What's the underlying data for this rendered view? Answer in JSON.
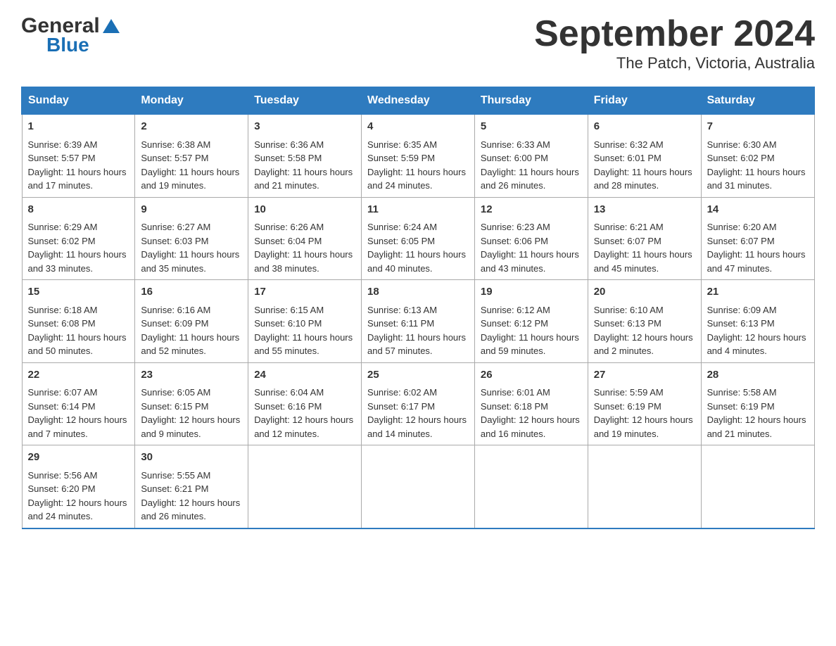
{
  "logo": {
    "general": "General",
    "blue": "Blue"
  },
  "title": "September 2024",
  "subtitle": "The Patch, Victoria, Australia",
  "days": [
    "Sunday",
    "Monday",
    "Tuesday",
    "Wednesday",
    "Thursday",
    "Friday",
    "Saturday"
  ],
  "weeks": [
    [
      {
        "day": "1",
        "sunrise": "6:39 AM",
        "sunset": "5:57 PM",
        "daylight": "11 hours and 17 minutes."
      },
      {
        "day": "2",
        "sunrise": "6:38 AM",
        "sunset": "5:57 PM",
        "daylight": "11 hours and 19 minutes."
      },
      {
        "day": "3",
        "sunrise": "6:36 AM",
        "sunset": "5:58 PM",
        "daylight": "11 hours and 21 minutes."
      },
      {
        "day": "4",
        "sunrise": "6:35 AM",
        "sunset": "5:59 PM",
        "daylight": "11 hours and 24 minutes."
      },
      {
        "day": "5",
        "sunrise": "6:33 AM",
        "sunset": "6:00 PM",
        "daylight": "11 hours and 26 minutes."
      },
      {
        "day": "6",
        "sunrise": "6:32 AM",
        "sunset": "6:01 PM",
        "daylight": "11 hours and 28 minutes."
      },
      {
        "day": "7",
        "sunrise": "6:30 AM",
        "sunset": "6:02 PM",
        "daylight": "11 hours and 31 minutes."
      }
    ],
    [
      {
        "day": "8",
        "sunrise": "6:29 AM",
        "sunset": "6:02 PM",
        "daylight": "11 hours and 33 minutes."
      },
      {
        "day": "9",
        "sunrise": "6:27 AM",
        "sunset": "6:03 PM",
        "daylight": "11 hours and 35 minutes."
      },
      {
        "day": "10",
        "sunrise": "6:26 AM",
        "sunset": "6:04 PM",
        "daylight": "11 hours and 38 minutes."
      },
      {
        "day": "11",
        "sunrise": "6:24 AM",
        "sunset": "6:05 PM",
        "daylight": "11 hours and 40 minutes."
      },
      {
        "day": "12",
        "sunrise": "6:23 AM",
        "sunset": "6:06 PM",
        "daylight": "11 hours and 43 minutes."
      },
      {
        "day": "13",
        "sunrise": "6:21 AM",
        "sunset": "6:07 PM",
        "daylight": "11 hours and 45 minutes."
      },
      {
        "day": "14",
        "sunrise": "6:20 AM",
        "sunset": "6:07 PM",
        "daylight": "11 hours and 47 minutes."
      }
    ],
    [
      {
        "day": "15",
        "sunrise": "6:18 AM",
        "sunset": "6:08 PM",
        "daylight": "11 hours and 50 minutes."
      },
      {
        "day": "16",
        "sunrise": "6:16 AM",
        "sunset": "6:09 PM",
        "daylight": "11 hours and 52 minutes."
      },
      {
        "day": "17",
        "sunrise": "6:15 AM",
        "sunset": "6:10 PM",
        "daylight": "11 hours and 55 minutes."
      },
      {
        "day": "18",
        "sunrise": "6:13 AM",
        "sunset": "6:11 PM",
        "daylight": "11 hours and 57 minutes."
      },
      {
        "day": "19",
        "sunrise": "6:12 AM",
        "sunset": "6:12 PM",
        "daylight": "11 hours and 59 minutes."
      },
      {
        "day": "20",
        "sunrise": "6:10 AM",
        "sunset": "6:13 PM",
        "daylight": "12 hours and 2 minutes."
      },
      {
        "day": "21",
        "sunrise": "6:09 AM",
        "sunset": "6:13 PM",
        "daylight": "12 hours and 4 minutes."
      }
    ],
    [
      {
        "day": "22",
        "sunrise": "6:07 AM",
        "sunset": "6:14 PM",
        "daylight": "12 hours and 7 minutes."
      },
      {
        "day": "23",
        "sunrise": "6:05 AM",
        "sunset": "6:15 PM",
        "daylight": "12 hours and 9 minutes."
      },
      {
        "day": "24",
        "sunrise": "6:04 AM",
        "sunset": "6:16 PM",
        "daylight": "12 hours and 12 minutes."
      },
      {
        "day": "25",
        "sunrise": "6:02 AM",
        "sunset": "6:17 PM",
        "daylight": "12 hours and 14 minutes."
      },
      {
        "day": "26",
        "sunrise": "6:01 AM",
        "sunset": "6:18 PM",
        "daylight": "12 hours and 16 minutes."
      },
      {
        "day": "27",
        "sunrise": "5:59 AM",
        "sunset": "6:19 PM",
        "daylight": "12 hours and 19 minutes."
      },
      {
        "day": "28",
        "sunrise": "5:58 AM",
        "sunset": "6:19 PM",
        "daylight": "12 hours and 21 minutes."
      }
    ],
    [
      {
        "day": "29",
        "sunrise": "5:56 AM",
        "sunset": "6:20 PM",
        "daylight": "12 hours and 24 minutes."
      },
      {
        "day": "30",
        "sunrise": "5:55 AM",
        "sunset": "6:21 PM",
        "daylight": "12 hours and 26 minutes."
      },
      null,
      null,
      null,
      null,
      null
    ]
  ],
  "labels": {
    "sunrise": "Sunrise:",
    "sunset": "Sunset:",
    "daylight": "Daylight:"
  }
}
